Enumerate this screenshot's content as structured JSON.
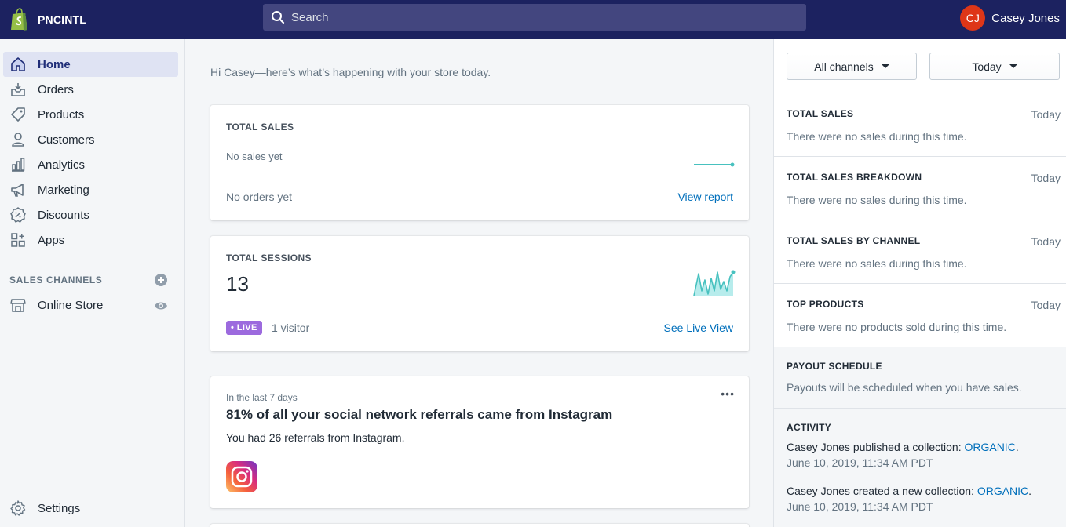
{
  "topbar": {
    "store_name": "PNCINTL",
    "search_placeholder": "Search",
    "user_initials": "CJ",
    "user_name": "Casey Jones"
  },
  "sidebar": {
    "items": [
      {
        "label": "Home",
        "icon": "home-icon"
      },
      {
        "label": "Orders",
        "icon": "orders-icon"
      },
      {
        "label": "Products",
        "icon": "tag-icon"
      },
      {
        "label": "Customers",
        "icon": "person-icon"
      },
      {
        "label": "Analytics",
        "icon": "bar-chart-icon"
      },
      {
        "label": "Marketing",
        "icon": "megaphone-icon"
      },
      {
        "label": "Discounts",
        "icon": "discount-icon"
      },
      {
        "label": "Apps",
        "icon": "apps-icon"
      }
    ],
    "sales_channels_title": "SALES CHANNELS",
    "online_store_label": "Online Store",
    "settings_label": "Settings"
  },
  "main": {
    "greeting": "Hi Casey—here’s what’s happening with your store today.",
    "total_sales": {
      "title": "TOTAL SALES",
      "subtitle": "No sales yet",
      "orders": "No orders yet",
      "link": "View report"
    },
    "total_sessions": {
      "title": "TOTAL SESSIONS",
      "value": "13",
      "badge": "• LIVE",
      "visitors": "1 visitor",
      "link": "See Live View"
    },
    "insight": {
      "period": "In the last 7 days",
      "headline": "81% of all your social network referrals came from Instagram",
      "detail": "You had 26 referrals from Instagram.",
      "more": "•••"
    }
  },
  "right_panel": {
    "channels_button": "All channels",
    "date_button": "Today",
    "sections": [
      {
        "title": "TOTAL SALES",
        "when": "Today",
        "text": "There were no sales during this time."
      },
      {
        "title": "TOTAL SALES BREAKDOWN",
        "when": "Today",
        "text": "There were no sales during this time."
      },
      {
        "title": "TOTAL SALES BY CHANNEL",
        "when": "Today",
        "text": "There were no sales during this time."
      },
      {
        "title": "TOP PRODUCTS",
        "when": "Today",
        "text": "There were no products sold during this time."
      }
    ],
    "payout": {
      "title": "PAYOUT SCHEDULE",
      "text": "Payouts will be scheduled when you have sales."
    },
    "activity": {
      "title": "ACTIVITY",
      "items": [
        {
          "text": "Casey Jones published a collection: ",
          "link": "ORGANIC",
          "end": ".",
          "date": "June 10, 2019, 11:34 AM PDT"
        },
        {
          "text": "Casey Jones created a new collection: ",
          "link": "ORGANIC",
          "end": ".",
          "date": "June 10, 2019, 11:34 AM PDT"
        }
      ]
    }
  },
  "colors": {
    "topbar": "#1c2260",
    "link": "#006fbb",
    "live": "#9c6ade",
    "sparkline": "#47c1bf",
    "avatar": "#de3618"
  }
}
